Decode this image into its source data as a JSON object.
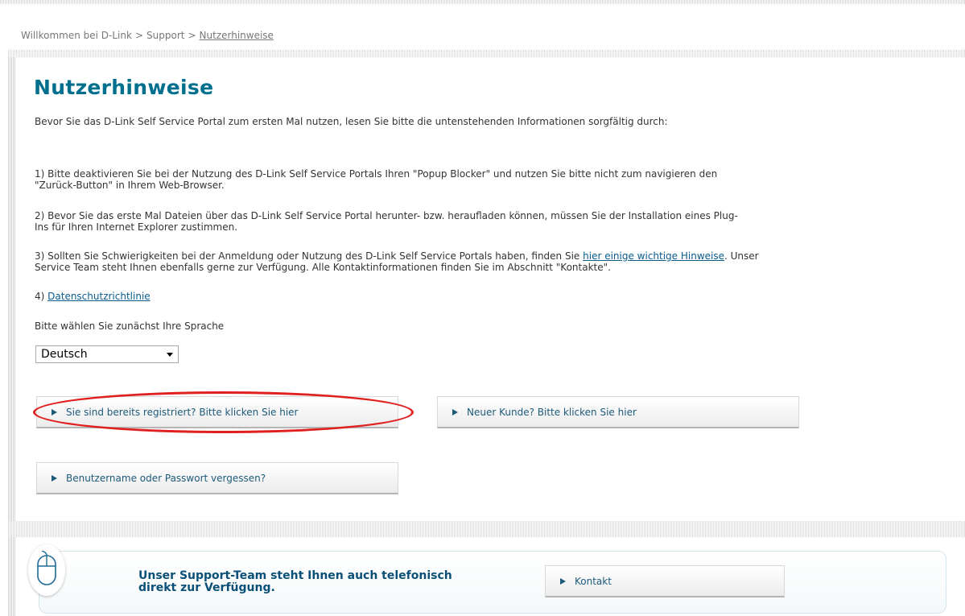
{
  "breadcrumb": {
    "home": "Willkommen bei D-Link",
    "separator": ">",
    "support": "Support",
    "current": "Nutzerhinweise"
  },
  "page": {
    "title": "Nutzerhinweise",
    "intro": "Bevor Sie das D-Link Self Service Portal zum ersten Mal nutzen, lesen Sie bitte die untenstehenden Informationen sorgfältig durch:"
  },
  "notes": {
    "item1_line1": "1) Bitte deaktivieren Sie bei der Nutzung des D-Link Self Service Portals Ihren \"Popup Blocker\" und nutzen Sie bitte nicht zum navigieren den",
    "item1_line2": "\"Zurück-Button\" in Ihrem Web-Browser.",
    "item2_line1": "2) Bevor Sie das erste Mal Dateien über das D-Link Self Service Portal herunter- bzw. heraufladen können, müssen Sie der Installation eines Plug-",
    "item2_line2": "Ins für Ihren Internet Explorer zustimmen.",
    "item3_prefix": "3) Sollten Sie Schwierigkeiten bei der Anmeldung oder Nutzung des D-Link Self Service Portals haben, finden Sie ",
    "item3_link": "hier einige wichtige Hinweise",
    "item3_suffix": ". Unser",
    "item3_line2": "Service Team steht Ihnen ebenfalls gerne zur Verfügung. Alle Kontaktinformationen finden Sie im Abschnitt \"Kontakte\".",
    "item4_prefix": "4) ",
    "item4_link": "Datenschutzrichtlinie"
  },
  "language": {
    "label": "Bitte wählen Sie zunächst Ihre Sprache",
    "selected": "Deutsch"
  },
  "buttons": {
    "registered": "Sie sind bereits registriert? Bitte klicken Sie hier",
    "new_customer": "Neuer Kunde? Bitte klicken Sie hier",
    "forgot": "Benutzername oder Passwort vergessen?",
    "contact": "Kontakt"
  },
  "support": {
    "line1": "Unser Support-Team steht Ihnen auch telefonisch",
    "line2": "direkt zur Verfügung."
  },
  "colors": {
    "title": "#006f8d",
    "link": "#0a5c8f",
    "highlight": "#e01f1f",
    "button_text": "#1d5a7a"
  },
  "icons": {
    "mouse": "mouse-icon",
    "button_arrow": "triangle-right-icon",
    "select_arrow": "chevron-down-icon"
  }
}
